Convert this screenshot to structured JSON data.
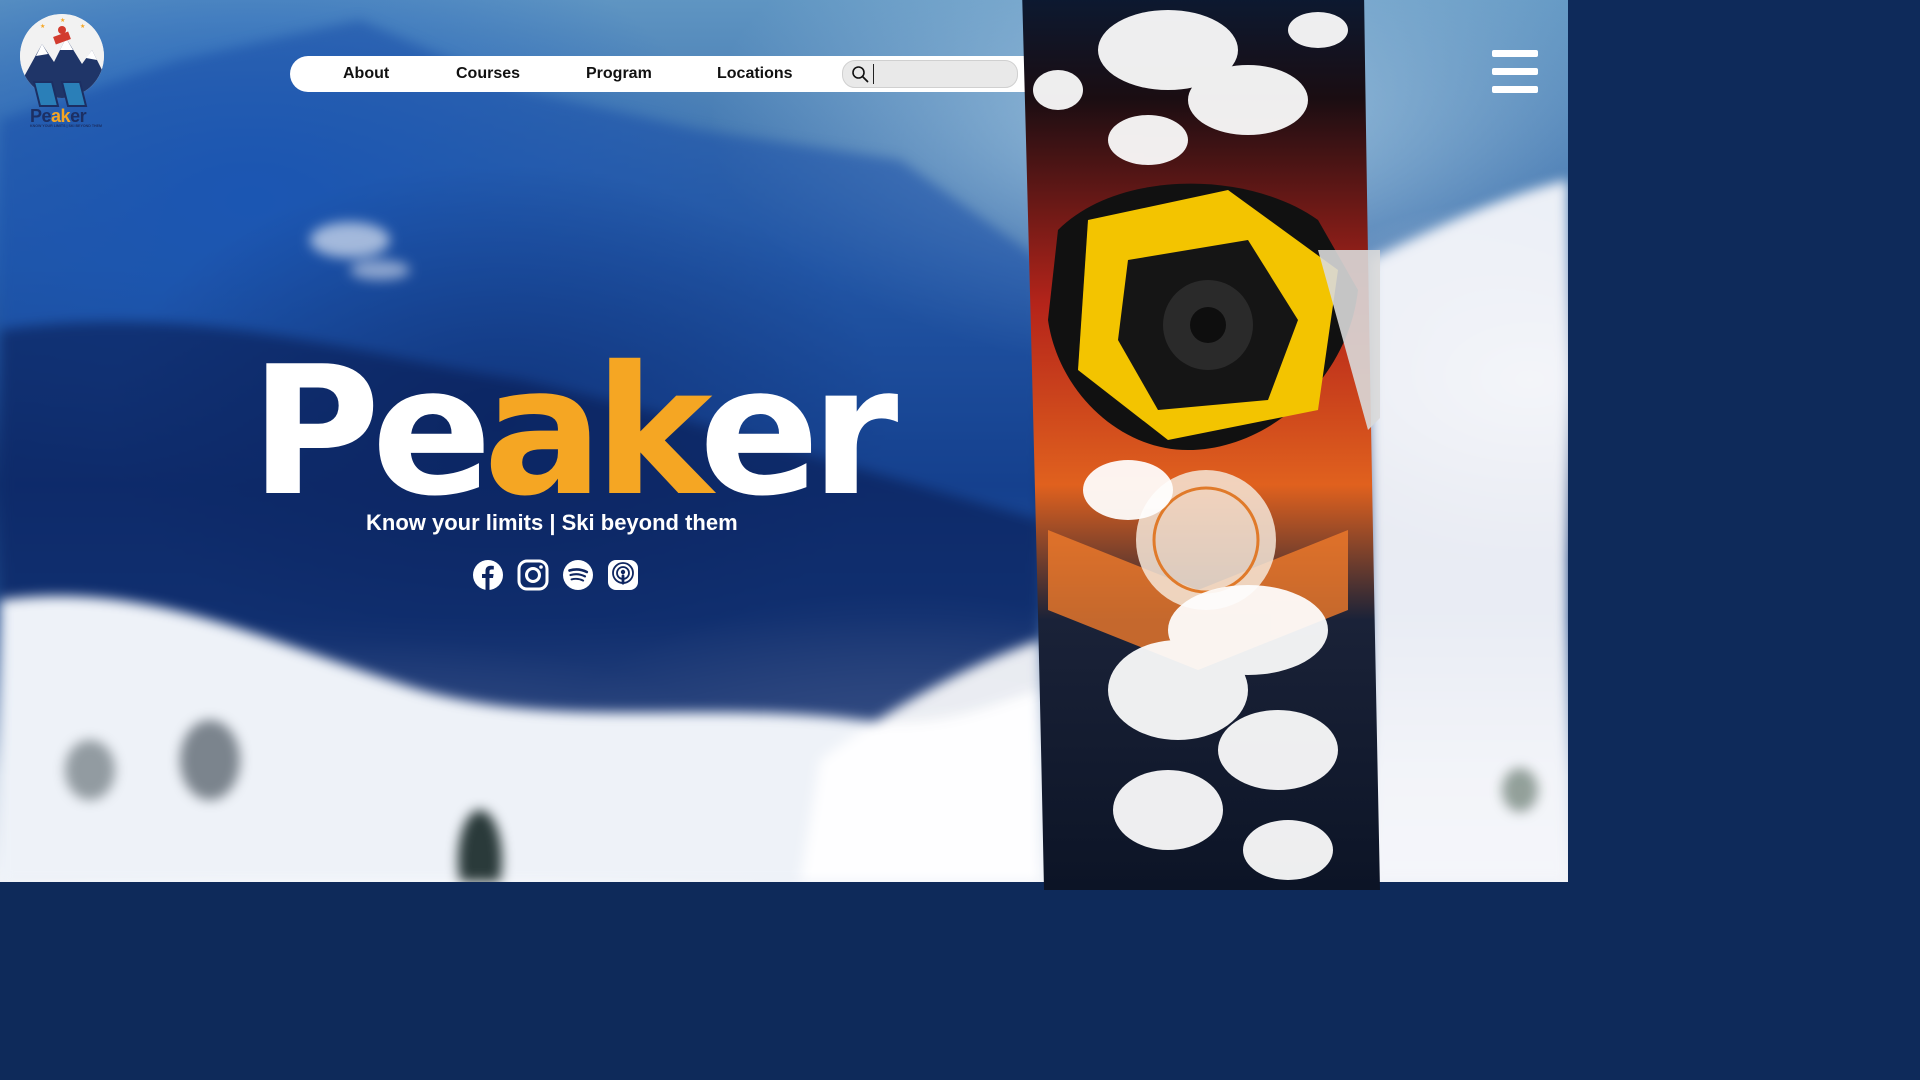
{
  "brand": {
    "logo_word_prefix": "Pe",
    "logo_word_accent": "ak",
    "logo_word_suffix": "er",
    "logo_tagline": "KNOW YOUR LIMITS | SKI BEYOND THEM"
  },
  "nav": {
    "items": [
      {
        "label": "About"
      },
      {
        "label": "Courses"
      },
      {
        "label": "Program"
      },
      {
        "label": "Locations"
      }
    ],
    "search": {
      "value": "",
      "placeholder": ""
    }
  },
  "hero": {
    "title_prefix": "Pe",
    "title_accent": "ak",
    "title_suffix": "er",
    "tagline": "Know your limits | Ski beyond them"
  },
  "socials": [
    {
      "icon": "facebook-icon"
    },
    {
      "icon": "instagram-icon"
    },
    {
      "icon": "spotify-icon"
    },
    {
      "icon": "podcasts-icon"
    }
  ],
  "colors": {
    "accent": "#f5a623",
    "nav_bg": "#ffffff",
    "text_light": "#ffffff"
  }
}
